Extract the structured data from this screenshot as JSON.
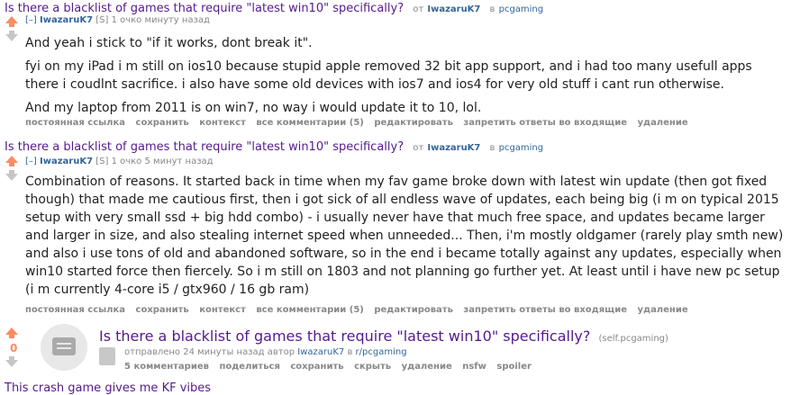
{
  "comment1": {
    "title": "Is there a blacklist of games that require \"latest win10\" specifically?",
    "by_label": "от",
    "author": "IwazaruK7",
    "in_label": "в",
    "subreddit": "pcgaming",
    "expand": "[–]",
    "user_name": "IwazaruK7",
    "flair": "[S]",
    "meta": "1 очко минуту назад",
    "paragraphs": [
      "And yeah i stick to \"if it works, dont break it\".",
      "fyi on my iPad i m still on ios10 because stupid apple removed 32 bit app support, and i had too many usefull apps there i coudlnt sacrifice. i also have some old devices with ios7 and ios4 for very old stuff i cant run otherwise.",
      "And my laptop from 2011 is on win7, no way i would update it to 10, lol."
    ],
    "buttons": [
      "постоянная ссылка",
      "сохранить",
      "контекст",
      "все комментарии (5)",
      "редактировать",
      "запретить ответы во входящие",
      "удаление"
    ]
  },
  "comment2": {
    "title": "Is there a blacklist of games that require \"latest win10\" specifically?",
    "by_label": "от",
    "author": "IwazaruK7",
    "in_label": "в",
    "subreddit": "pcgaming",
    "expand": "[–]",
    "user_name": "IwazaruK7",
    "flair": "[S]",
    "meta": "1 очко 5 минут назад",
    "paragraphs": [
      "Combination of reasons. It started back in time when my fav game broke down with latest win update (then got fixed though) that made me cautious first, then i got sick of all endless wave of updates, each being big (i m on typical 2015 setup with very small ssd + big hdd combo) - i usually never have that much free space, and updates became larger and larger in size, and also stealing internet speed when unneeded... Then, i'm mostly oldgamer (rarely play smth new) and also i use tons of old and abandoned software, so in the end i became totally against any updates, especially when win10 started force then fiercely. So i m still on 1803 and not planning go further yet. At least until i have new pc setup (i m currently 4-core i5 / gtx960 / 16 gb ram)"
    ],
    "buttons": [
      "постоянная ссылка",
      "сохранить",
      "контекст",
      "все комментарии (5)",
      "редактировать",
      "запретить ответы во входящие",
      "удаление"
    ]
  },
  "post": {
    "score": "0",
    "title": "Is there a blacklist of games that require \"latest win10\" specifically?",
    "domain": "(self.pcgaming)",
    "submitted": "отправлено 24 минуты назад автор",
    "author": "IwazaruK7",
    "in_label": "в",
    "subreddit": "r/pcgaming",
    "buttons": [
      "5 комментариев",
      "поделиться",
      "сохранить",
      "скрыть",
      "удаление",
      "nsfw",
      "spoiler"
    ]
  },
  "next_title": "This crash game gives me KF vibes"
}
